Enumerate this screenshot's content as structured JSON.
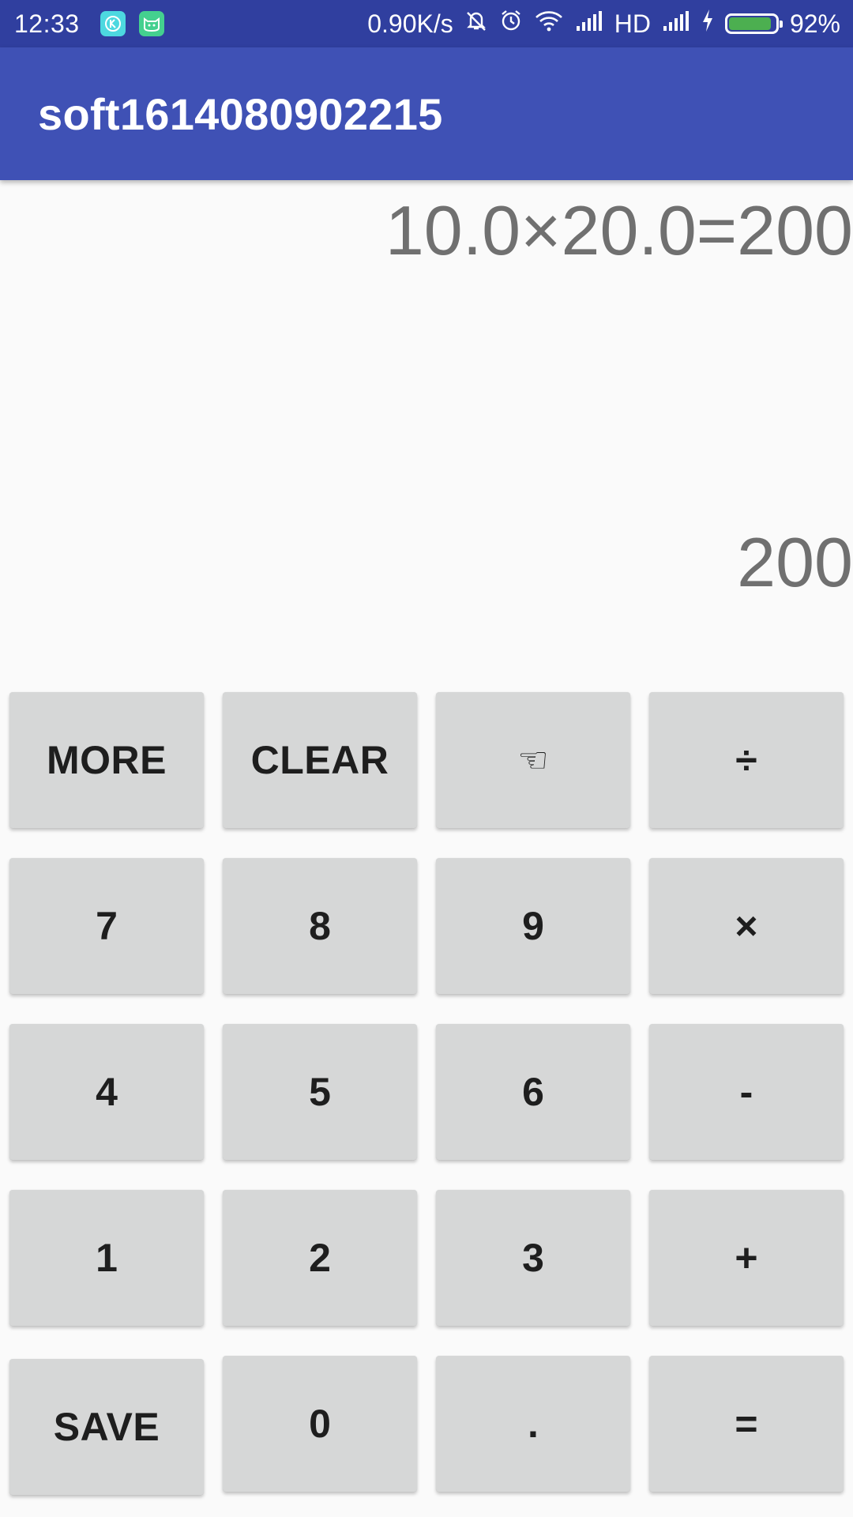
{
  "status_bar": {
    "time": "12:33",
    "network_speed": "0.90K/s",
    "network_type": "HD",
    "battery_percent": "92%",
    "battery_level": 0.92,
    "battery_color": "#4caf50",
    "icons": [
      "k-app-icon",
      "cat-app-icon",
      "muted-bell-icon",
      "alarm-icon",
      "wifi-icon",
      "signal-icon",
      "signal-icon-2",
      "charging-icon",
      "battery-icon"
    ]
  },
  "app_bar": {
    "title": "soft1614080902215",
    "color": "#3f51b5"
  },
  "display": {
    "expression": "10.0×20.0=200",
    "result": "200"
  },
  "keypad": {
    "rows": [
      [
        "MORE",
        "CLEAR",
        "☜",
        "÷"
      ],
      [
        "7",
        "8",
        "9",
        "×"
      ],
      [
        "4",
        "5",
        "6",
        "-"
      ],
      [
        "1",
        "2",
        "3",
        "+"
      ],
      [
        "SAVE",
        "0",
        ".",
        "="
      ]
    ]
  }
}
